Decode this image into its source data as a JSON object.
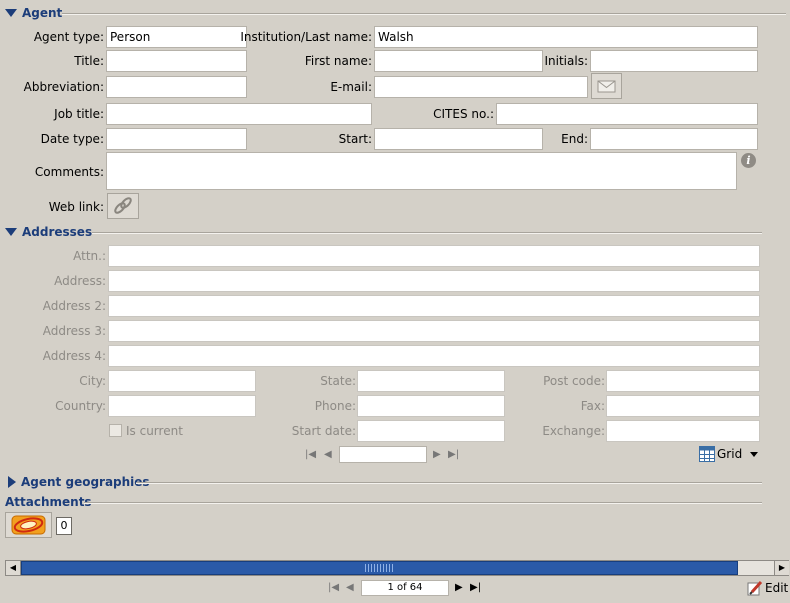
{
  "agent": {
    "section_title": "Agent",
    "labels": {
      "agent_type": "Agent type:",
      "institution": "Institution/Last name:",
      "title": "Title:",
      "first_name": "First name:",
      "initials": "Initials:",
      "abbreviation": "Abbreviation:",
      "email": "E-mail:",
      "job_title": "Job title:",
      "cites": "CITES no.:",
      "date_type": "Date type:",
      "start": "Start:",
      "end": "End:",
      "comments": "Comments:",
      "web_link": "Web link:"
    },
    "values": {
      "agent_type": "Person",
      "institution": "Walsh",
      "title": "",
      "first_name": "",
      "initials": "",
      "abbreviation": "",
      "email": "",
      "job_title": "",
      "cites": "",
      "date_type": "",
      "start": "",
      "end": "",
      "comments": ""
    }
  },
  "addresses": {
    "section_title": "Addresses",
    "labels": {
      "attn": "Attn.:",
      "address": "Address:",
      "address2": "Address 2:",
      "address3": "Address 3:",
      "address4": "Address 4:",
      "city": "City:",
      "state": "State:",
      "post_code": "Post code:",
      "country": "Country:",
      "phone": "Phone:",
      "fax": "Fax:",
      "is_current": "Is current",
      "start_date": "Start date:",
      "exchange": "Exchange:"
    },
    "grid_label": "Grid",
    "record_value": ""
  },
  "agent_geographies": {
    "section_title": "Agent geographies"
  },
  "attachments": {
    "section_title": "Attachments",
    "count": "0"
  },
  "footer": {
    "record_indicator": "1 of 64",
    "edit_label": "Edit"
  },
  "colors": {
    "section_title": "#1c3d7a",
    "scrollbar_thumb": "#2a5aa8",
    "background": "#d4d0c8"
  },
  "icons": [
    "collapse-triangle-icon",
    "expand-triangle-icon",
    "mail-icon",
    "info-icon",
    "web-link-icon",
    "first-page-icon",
    "previous-icon",
    "next-icon",
    "last-page-icon",
    "grid-icon",
    "dropdown-arrow-icon",
    "attachment-icon",
    "scroll-left-icon",
    "scroll-right-icon",
    "edit-icon"
  ]
}
